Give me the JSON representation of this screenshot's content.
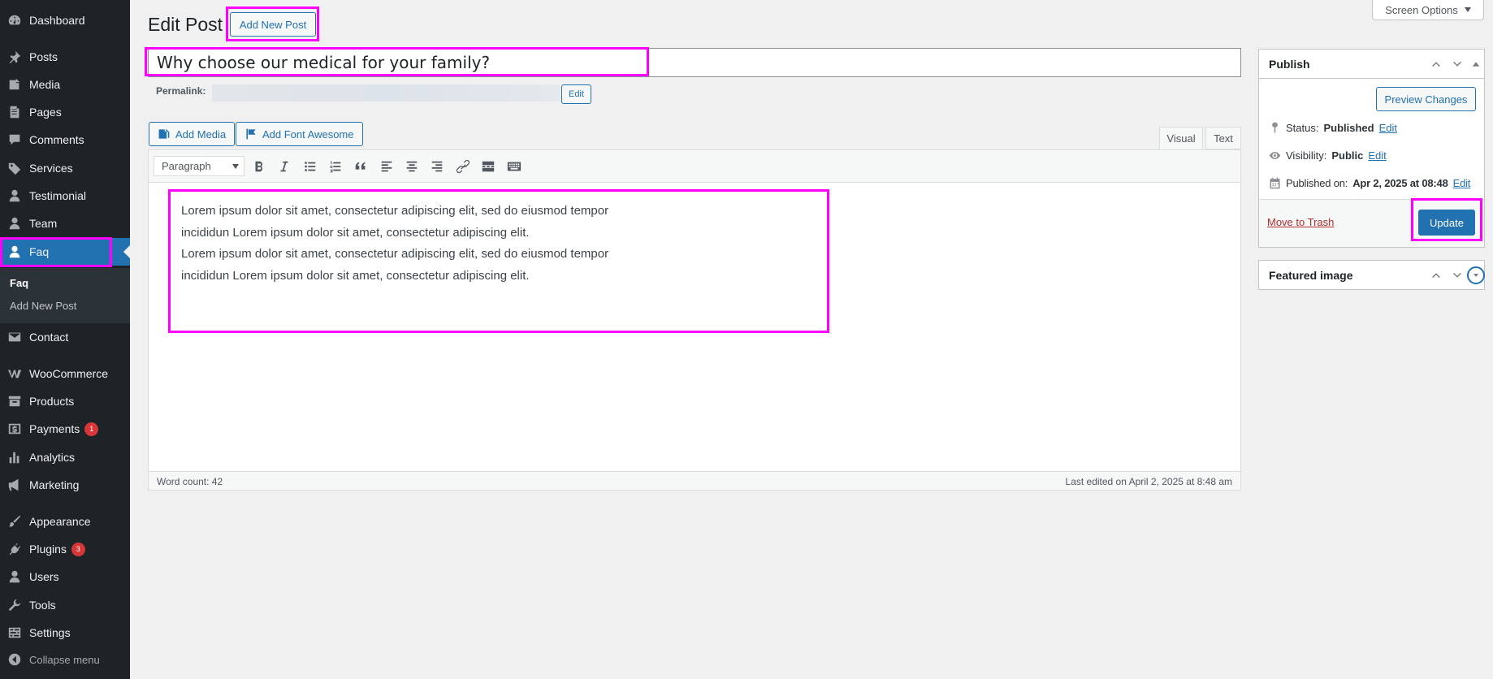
{
  "sidebar": {
    "items": [
      {
        "label": "Dashboard",
        "icon": "dashboard-icon"
      },
      {
        "label": "Posts",
        "icon": "pin-icon"
      },
      {
        "label": "Media",
        "icon": "media-icon"
      },
      {
        "label": "Pages",
        "icon": "pages-icon"
      },
      {
        "label": "Comments",
        "icon": "comment-icon"
      },
      {
        "label": "Services",
        "icon": "tag-icon"
      },
      {
        "label": "Testimonial",
        "icon": "user-icon"
      },
      {
        "label": "Team",
        "icon": "user-icon"
      },
      {
        "label": "Faq",
        "icon": "user-icon"
      },
      {
        "label": "Contact",
        "icon": "mail-icon"
      },
      {
        "label": "WooCommerce",
        "icon": "woo-icon"
      },
      {
        "label": "Products",
        "icon": "archive-icon"
      },
      {
        "label": "Payments",
        "icon": "dollar-icon",
        "badge": "1"
      },
      {
        "label": "Analytics",
        "icon": "bar-chart-icon"
      },
      {
        "label": "Marketing",
        "icon": "megaphone-icon"
      },
      {
        "label": "Appearance",
        "icon": "brush-icon"
      },
      {
        "label": "Plugins",
        "icon": "plug-icon",
        "badge": "3"
      },
      {
        "label": "Users",
        "icon": "user-icon"
      },
      {
        "label": "Tools",
        "icon": "wrench-icon"
      },
      {
        "label": "Settings",
        "icon": "settings-icon"
      }
    ],
    "submenu": {
      "current": "Faq",
      "add_new": "Add New Post"
    },
    "collapse_label": "Collapse menu",
    "active_color": "#2271b1",
    "bg_color": "#1d2327"
  },
  "header": {
    "title": "Edit Post",
    "add_new": "Add New Post",
    "screen_options": "Screen Options"
  },
  "post": {
    "title": "Why choose our medical for your family?",
    "permalink_label": "Permalink:",
    "permalink_edit": "Edit",
    "content_lines": [
      "Lorem ipsum dolor sit amet, consectetur adipiscing elit, sed do eiusmod tempor",
      "incididun Lorem ipsum dolor sit amet, consectetur adipiscing elit.",
      "Lorem ipsum dolor sit amet, consectetur adipiscing elit, sed do eiusmod tempor",
      "incididun Lorem ipsum dolor sit amet, consectetur adipiscing elit."
    ]
  },
  "editor": {
    "add_media": "Add Media",
    "add_font_awesome": "Add Font Awesome",
    "tab_visual": "Visual",
    "tab_text": "Text",
    "format": "Paragraph",
    "word_count": "Word count: 42",
    "last_edited": "Last edited on April 2, 2025 at 8:48 am"
  },
  "publish": {
    "title": "Publish",
    "preview": "Preview Changes",
    "status_label": "Status:",
    "status_value": "Published",
    "visibility_label": "Visibility:",
    "visibility_value": "Public",
    "published_label": "Published on:",
    "published_value": "Apr 2, 2025 at 08:48",
    "edit": "Edit",
    "trash": "Move to Trash",
    "update": "Update"
  },
  "featured_image": {
    "title": "Featured image"
  },
  "highlight_color": "#ff00ff"
}
